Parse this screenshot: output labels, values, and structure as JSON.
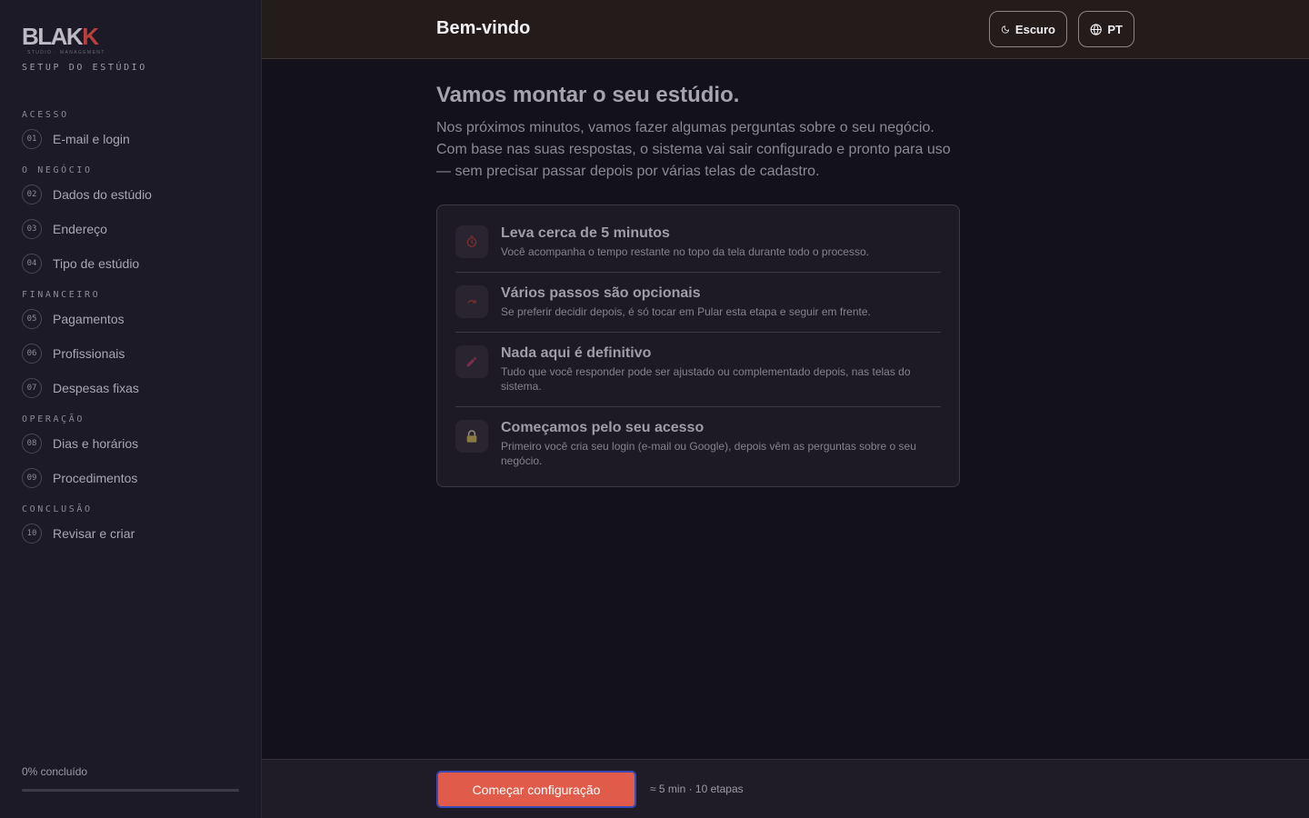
{
  "sidebar": {
    "logo_main": "BLAK",
    "logo_accent": "K",
    "logo_sub": "STUDIO · MANAGEMENT",
    "setup_label": "SETUP DO ESTÚDIO",
    "sections": [
      {
        "title": "ACESSO",
        "items": [
          {
            "num": "01",
            "label": "E-mail e login"
          }
        ]
      },
      {
        "title": "O NEGÓCIO",
        "items": [
          {
            "num": "02",
            "label": "Dados do estúdio"
          },
          {
            "num": "03",
            "label": "Endereço"
          },
          {
            "num": "04",
            "label": "Tipo de estúdio"
          }
        ]
      },
      {
        "title": "FINANCEIRO",
        "items": [
          {
            "num": "05",
            "label": "Pagamentos"
          },
          {
            "num": "06",
            "label": "Profissionais"
          },
          {
            "num": "07",
            "label": "Despesas fixas"
          }
        ]
      },
      {
        "title": "OPERAÇÃO",
        "items": [
          {
            "num": "08",
            "label": "Dias e horários"
          },
          {
            "num": "09",
            "label": "Procedimentos"
          }
        ]
      },
      {
        "title": "CONCLUSÃO",
        "items": [
          {
            "num": "10",
            "label": "Revisar e criar"
          }
        ]
      }
    ],
    "progress_text": "0% concluído",
    "progress_percent": 0
  },
  "header": {
    "title": "Bem-vindo",
    "theme_label": "Escuro",
    "lang_label": "PT"
  },
  "main": {
    "heading": "Vamos montar o seu estúdio.",
    "intro": "Nos próximos minutos, vamos fazer algumas perguntas sobre o seu negócio. Com base nas suas respostas, o sistema vai sair configurado e pronto para uso — sem precisar passar depois por várias telas de cadastro.",
    "info_rows": [
      {
        "icon": "stopwatch-icon",
        "title": "Leva cerca de 5 minutos",
        "desc": "Você acompanha o tempo restante no topo da tela durante todo o processo."
      },
      {
        "icon": "skip-icon",
        "title": "Vários passos são opcionais",
        "desc": "Se preferir decidir depois, é só tocar em Pular esta etapa e seguir em frente."
      },
      {
        "icon": "pencil-icon",
        "title": "Nada aqui é definitivo",
        "desc": "Tudo que você responder pode ser ajustado ou complementado depois, nas telas do sistema."
      },
      {
        "icon": "lock-icon",
        "title": "Começamos pelo seu acesso",
        "desc": "Primeiro você cria seu login (e-mail ou Google), depois vêm as perguntas sobre o seu negócio."
      }
    ]
  },
  "footer": {
    "start_label": "Começar configuração",
    "meta": "≈ 5 min · 10 etapas"
  },
  "colors": {
    "accent": "#e05b49",
    "sidebar_bg": "#1c1a26",
    "main_bg": "#13121b",
    "header_bg": "#241c1b"
  }
}
